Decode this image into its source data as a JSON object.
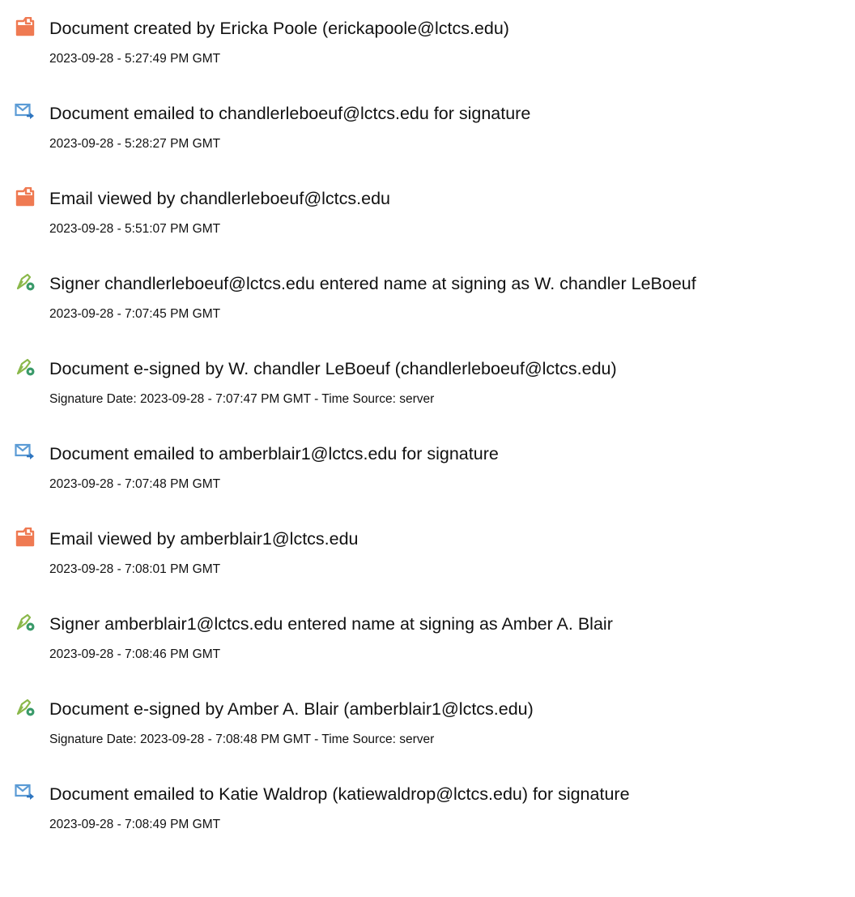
{
  "colors": {
    "document_icon": "#ef7a52",
    "email_icon": "#5b9bd5",
    "email_arrow": "#2f76c0",
    "sign_icon": "#8ab84a",
    "sign_badge": "#3a9a6a",
    "text": "#111111"
  },
  "events": [
    {
      "icon": "document-icon",
      "title": "Document created by Ericka Poole (erickapoole@lctcs.edu)",
      "detail": "2023-09-28 - 5:27:49 PM GMT"
    },
    {
      "icon": "email-sent-icon",
      "title": "Document emailed to chandlerleboeuf@lctcs.edu for signature",
      "detail": "2023-09-28 - 5:28:27 PM GMT"
    },
    {
      "icon": "document-icon",
      "title": "Email viewed by chandlerleboeuf@lctcs.edu",
      "detail": "2023-09-28 - 5:51:07 PM GMT"
    },
    {
      "icon": "e-sign-pen-icon",
      "title": "Signer chandlerleboeuf@lctcs.edu entered name at signing as W. chandler LeBoeuf",
      "detail": "2023-09-28 - 7:07:45 PM GMT"
    },
    {
      "icon": "e-sign-pen-icon",
      "title": "Document e-signed by W. chandler LeBoeuf (chandlerleboeuf@lctcs.edu)",
      "detail": "Signature Date: 2023-09-28 - 7:07:47 PM GMT - Time Source: server"
    },
    {
      "icon": "email-sent-icon",
      "title": "Document emailed to amberblair1@lctcs.edu for signature",
      "detail": "2023-09-28 - 7:07:48 PM GMT"
    },
    {
      "icon": "document-icon",
      "title": "Email viewed by amberblair1@lctcs.edu",
      "detail": "2023-09-28 - 7:08:01 PM GMT"
    },
    {
      "icon": "e-sign-pen-icon",
      "title": "Signer amberblair1@lctcs.edu entered name at signing as Amber A. Blair",
      "detail": "2023-09-28 - 7:08:46 PM GMT"
    },
    {
      "icon": "e-sign-pen-icon",
      "title": "Document e-signed by Amber A. Blair (amberblair1@lctcs.edu)",
      "detail": "Signature Date: 2023-09-28 - 7:08:48 PM GMT - Time Source: server"
    },
    {
      "icon": "email-sent-icon",
      "title": "Document emailed to Katie Waldrop (katiewaldrop@lctcs.edu) for signature",
      "detail": "2023-09-28 - 7:08:49 PM GMT"
    }
  ]
}
